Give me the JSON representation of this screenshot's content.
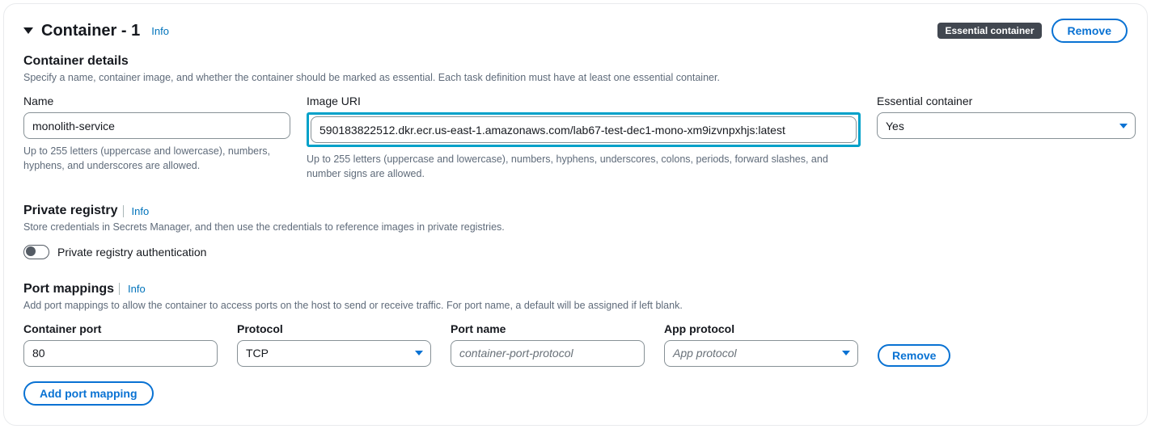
{
  "header": {
    "title": "Container - 1",
    "info": "Info",
    "badge": "Essential container",
    "remove": "Remove"
  },
  "details": {
    "heading": "Container details",
    "sub": "Specify a name, container image, and whether the container should be marked as essential. Each task definition must have at least one essential container.",
    "name_label": "Name",
    "name_value": "monolith-service",
    "name_helper": "Up to 255 letters (uppercase and lowercase), numbers, hyphens, and underscores are allowed.",
    "image_label": "Image URI",
    "image_value": "590183822512.dkr.ecr.us-east-1.amazonaws.com/lab67-test-dec1-mono-xm9izvnpxhjs:latest",
    "image_helper": "Up to 255 letters (uppercase and lowercase), numbers, hyphens, underscores, colons, periods, forward slashes, and number signs are allowed.",
    "essential_label": "Essential container",
    "essential_value": "Yes"
  },
  "private_registry": {
    "heading": "Private registry",
    "info": "Info",
    "sub": "Store credentials in Secrets Manager, and then use the credentials to reference images in private registries.",
    "toggle_label": "Private registry authentication"
  },
  "port_mappings": {
    "heading": "Port mappings",
    "info": "Info",
    "sub": "Add port mappings to allow the container to access ports on the host to send or receive traffic. For port name, a default will be assigned if left blank.",
    "container_port_label": "Container port",
    "container_port_value": "80",
    "protocol_label": "Protocol",
    "protocol_value": "TCP",
    "port_name_label": "Port name",
    "port_name_placeholder": "container-port-protocol",
    "app_protocol_label": "App protocol",
    "app_protocol_placeholder": "App protocol",
    "remove": "Remove",
    "add_btn": "Add port mapping"
  }
}
